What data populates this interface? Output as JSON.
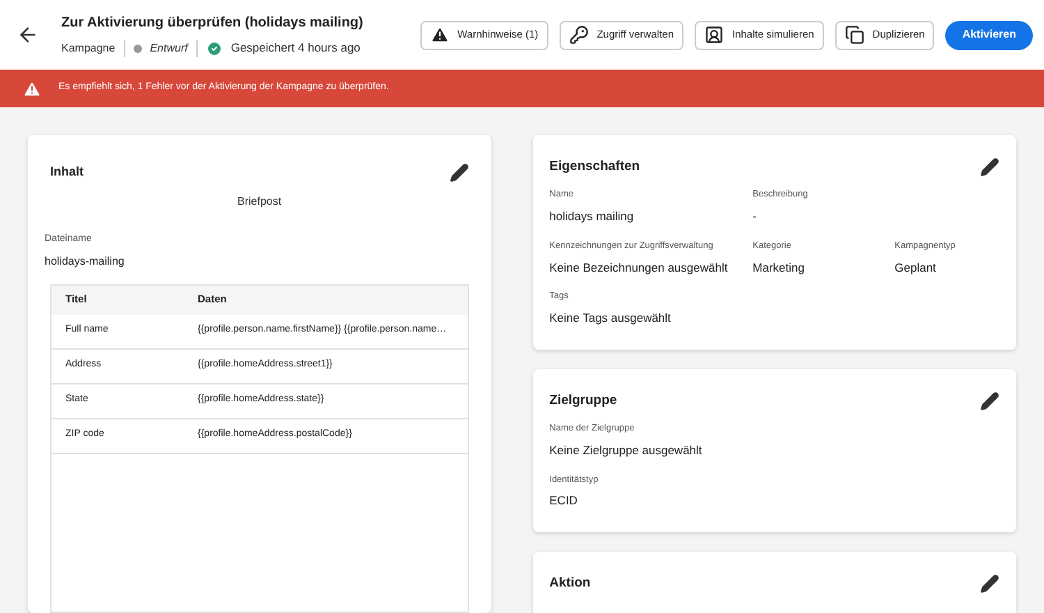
{
  "header": {
    "title": "Zur Aktivierung überprüfen (holidays mailing)",
    "object_type": "Kampagne",
    "status": "Entwurf",
    "saved": "Gespeichert 4 hours ago",
    "buttons": [
      {
        "kind": "warning",
        "label": "Warnhinweise (1)"
      },
      {
        "kind": "access",
        "label": "Zugriff verwalten"
      },
      {
        "kind": "simulate",
        "label": "Inhalte simulieren"
      },
      {
        "kind": "duplicate",
        "label": "Duplizieren"
      },
      {
        "kind": "primary",
        "label": "Aktivieren"
      }
    ]
  },
  "alert": {
    "text": "Es empfiehlt sich, 1 Fehler vor der Aktivierung der Kampagne zu überprüfen."
  },
  "content_card": {
    "title": "Inhalt",
    "channel": "Briefpost",
    "file_label": "Dateiname",
    "file_value": "holidays-mailing",
    "table": {
      "columns": [
        "Titel",
        "Daten"
      ],
      "rows": [
        [
          "Full name",
          "{{profile.person.name.firstName}} {{profile.person.name…"
        ],
        [
          "Address",
          "{{profile.homeAddress.street1}}"
        ],
        [
          "State",
          "{{profile.homeAddress.state}}"
        ],
        [
          "ZIP code",
          "{{profile.homeAddress.postalCode}}"
        ]
      ]
    }
  },
  "side_cards": [
    {
      "title": "Eigenschaften",
      "rows": [
        [
          {
            "label": "Name",
            "value": "holidays mailing"
          },
          {
            "label": "Beschreibung",
            "value": "-"
          }
        ],
        [
          {
            "label": "Kennzeichnungen zur Zugriffsverwaltung",
            "value": "Keine Bezeichnungen ausgewählt"
          },
          {
            "label": "Kategorie",
            "value": "Marketing"
          },
          {
            "label": "Kampagnentyp",
            "value": "Geplant"
          }
        ],
        [
          {
            "label": "Tags",
            "value": "Keine Tags ausgewählt"
          }
        ]
      ]
    },
    {
      "title": "Zielgruppe",
      "rows": [
        [
          {
            "label": "Name der Zielgruppe",
            "value": "Keine Zielgruppe ausgewählt"
          }
        ],
        [
          {
            "label": "Identitätstyp",
            "value": "ECID"
          }
        ]
      ]
    },
    {
      "title": "Aktion"
    }
  ]
}
